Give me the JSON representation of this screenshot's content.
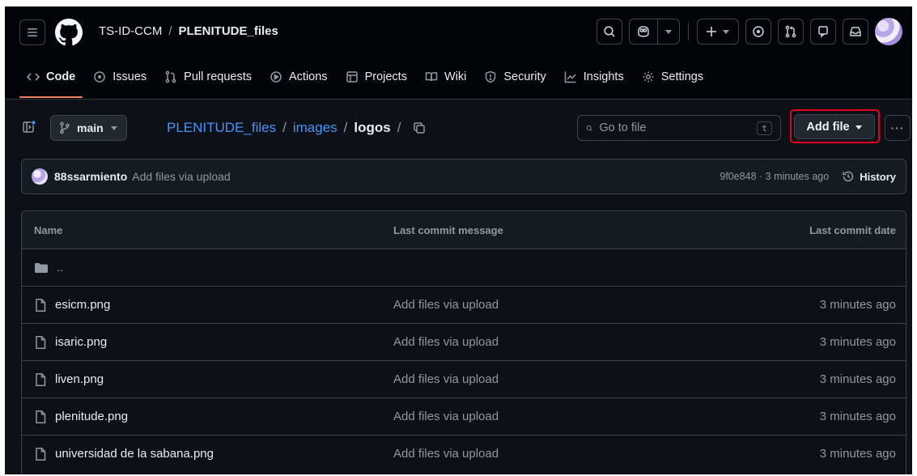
{
  "header": {
    "owner": "TS-ID-CCM",
    "separator": "/",
    "repo": "PLENITUDE_files",
    "icons": [
      "menu-icon",
      "github-logo-icon",
      "search-icon",
      "copilot-icon",
      "plus-icon",
      "issue-icon",
      "pull-request-icon",
      "discussion-icon",
      "inbox-icon"
    ]
  },
  "tabs": [
    {
      "label": "Code",
      "icon": "code-icon"
    },
    {
      "label": "Issues",
      "icon": "issue-icon"
    },
    {
      "label": "Pull requests",
      "icon": "pull-request-icon"
    },
    {
      "label": "Actions",
      "icon": "play-icon"
    },
    {
      "label": "Projects",
      "icon": "table-icon"
    },
    {
      "label": "Wiki",
      "icon": "book-icon"
    },
    {
      "label": "Security",
      "icon": "shield-icon"
    },
    {
      "label": "Insights",
      "icon": "graph-icon"
    },
    {
      "label": "Settings",
      "icon": "gear-icon"
    }
  ],
  "toolbar": {
    "branch": "main",
    "path": [
      "PLENITUDE_files",
      "images"
    ],
    "current": "logos",
    "separator": "/",
    "goto_placeholder": "Go to file",
    "goto_shortcut": "t",
    "add_file_label": "Add file",
    "more_label": "···"
  },
  "commit": {
    "author": "88ssarmiento",
    "message": "Add files via upload",
    "meta": "9f0e848 · 3 minutes ago",
    "history_label": "History"
  },
  "files_table": {
    "headers": {
      "name": "Name",
      "message": "Last commit message",
      "date": "Last commit date"
    },
    "parent": "..",
    "rows": [
      {
        "name": "esicm.png",
        "message": "Add files via upload",
        "date": "3 minutes ago"
      },
      {
        "name": "isaric.png",
        "message": "Add files via upload",
        "date": "3 minutes ago"
      },
      {
        "name": "liven.png",
        "message": "Add files via upload",
        "date": "3 minutes ago"
      },
      {
        "name": "plenitude.png",
        "message": "Add files via upload",
        "date": "3 minutes ago"
      },
      {
        "name": "universidad de la sabana.png",
        "message": "Add files via upload",
        "date": "3 minutes ago"
      }
    ]
  },
  "colors": {
    "background": "#0d1117",
    "header_bg": "#010409",
    "border": "#3d444d",
    "link": "#4493f8",
    "muted": "#9198a1",
    "active_tab_underline": "#f78166",
    "highlight_ring": "#e5001f"
  }
}
